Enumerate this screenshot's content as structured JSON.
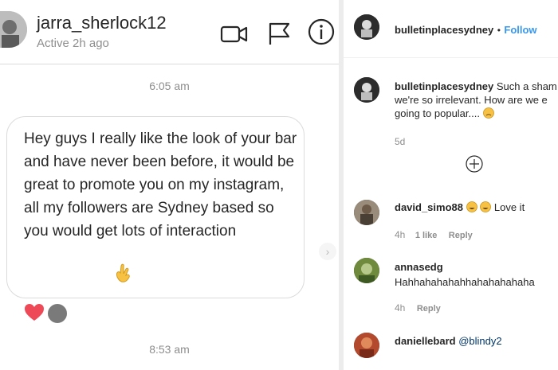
{
  "dm": {
    "username": "jarra_sherlock12",
    "status": "Active 2h ago",
    "timestamps": [
      "6:05 am",
      "8:53 am"
    ],
    "message": "Hey guys I really like the look of your bar and have never been before, it would be great to promote you on my instagram, all my followers are Sydney based so you would get lots of interaction",
    "icons": [
      "video-call-icon",
      "flag-icon",
      "info-icon"
    ]
  },
  "post": {
    "author": "bulletinplacesydney",
    "separator": "•",
    "follow_label": "Follow",
    "caption_author": "bulletinplacesydney",
    "caption_lines": [
      "Such a sham",
      "we're so irrelevant. How are we e",
      "going to popular...."
    ],
    "caption_age": "5d",
    "comments": [
      {
        "user": "david_simo88",
        "text": "Love it",
        "age": "4h",
        "likes": "1 like",
        "reply": "Reply"
      },
      {
        "user": "annasedg",
        "text": "Hahhahahahahhahahahahaha",
        "age": "4h",
        "reply": "Reply"
      },
      {
        "user": "daniellebard",
        "text": "@blindy2"
      }
    ]
  },
  "colors": {
    "link_blue": "#3897f0",
    "heart_red": "#ed4956",
    "muted": "#8e8e8e"
  }
}
